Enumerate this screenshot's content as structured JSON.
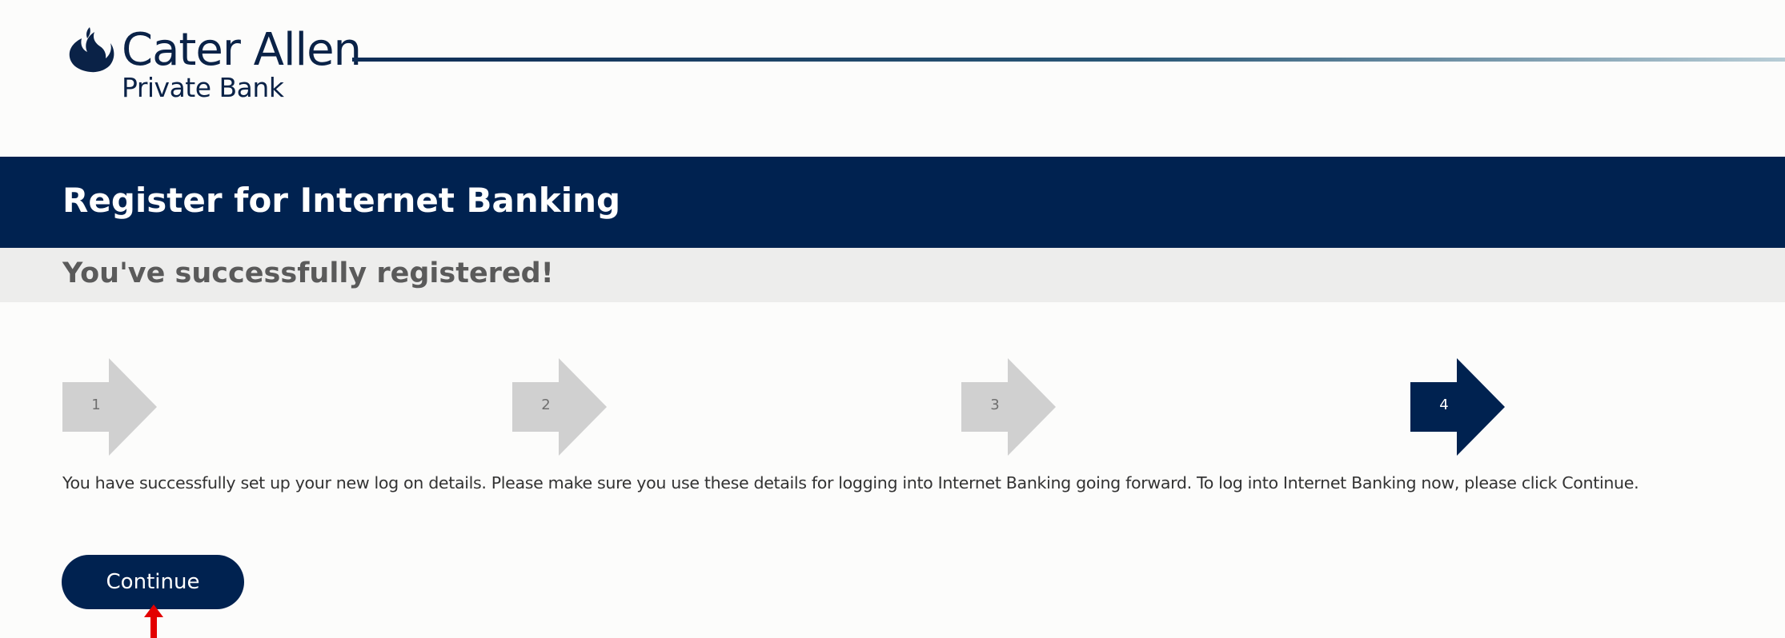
{
  "header": {
    "logo_name": "Cater Allen",
    "logo_sub": "Private Bank"
  },
  "page": {
    "title": "Register for Internet Banking",
    "subtitle": "You've successfully registered!"
  },
  "steps": [
    {
      "label": "1",
      "state": "inactive"
    },
    {
      "label": "2",
      "state": "inactive"
    },
    {
      "label": "3",
      "state": "inactive"
    },
    {
      "label": "4",
      "state": "active"
    }
  ],
  "message": "You have successfully set up your new log on details. Please make sure you use these details for logging into Internet Banking going forward. To log into Internet Banking now, please click Continue.",
  "continue_label": "Continue",
  "colors": {
    "brand_navy": "#002250",
    "step_inactive": "#d0d0d0",
    "subtitle_band": "#ededec",
    "annotation": "#e30000"
  },
  "icons": {
    "logo": "flame-icon",
    "annotation": "arrow-up-icon"
  }
}
